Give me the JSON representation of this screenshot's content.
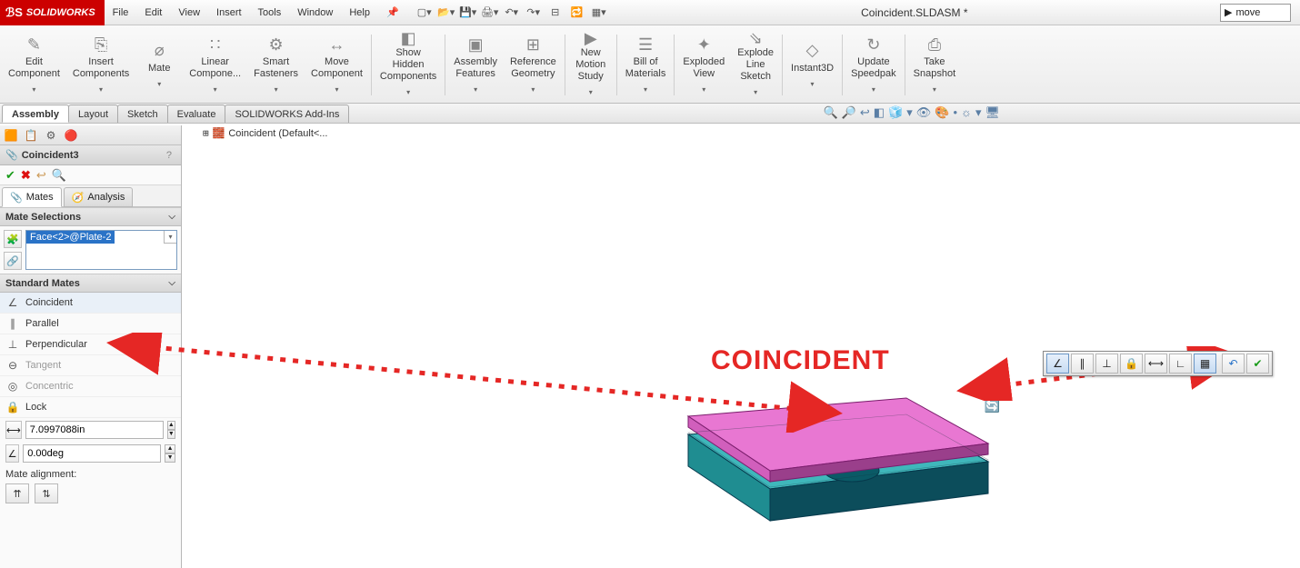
{
  "app": {
    "brand": "SOLIDWORKS",
    "title": "Coincident.SLDASM *",
    "search_value": "move"
  },
  "menu": {
    "items": [
      "File",
      "Edit",
      "View",
      "Insert",
      "Tools",
      "Window",
      "Help"
    ]
  },
  "ribbon": {
    "buttons": [
      {
        "label": "Edit\nComponent",
        "icon": "✎"
      },
      {
        "label": "Insert\nComponents",
        "icon": "⎘"
      },
      {
        "label": "Mate",
        "icon": "⌀"
      },
      {
        "label": "Linear\nCompone...",
        "icon": "∷"
      },
      {
        "label": "Smart\nFasteners",
        "icon": "⚙"
      },
      {
        "label": "Move\nComponent",
        "icon": "↔"
      },
      {
        "label": "|"
      },
      {
        "label": "Show\nHidden\nComponents",
        "icon": "◧"
      },
      {
        "label": "|"
      },
      {
        "label": "Assembly\nFeatures",
        "icon": "▣"
      },
      {
        "label": "Reference\nGeometry",
        "icon": "⊞"
      },
      {
        "label": "|"
      },
      {
        "label": "New\nMotion\nStudy",
        "icon": "▶"
      },
      {
        "label": "|"
      },
      {
        "label": "Bill of\nMaterials",
        "icon": "☰"
      },
      {
        "label": "|"
      },
      {
        "label": "Exploded\nView",
        "icon": "✦"
      },
      {
        "label": "Explode\nLine\nSketch",
        "icon": "⇘"
      },
      {
        "label": "|"
      },
      {
        "label": "Instant3D",
        "icon": "◇"
      },
      {
        "label": "|"
      },
      {
        "label": "Update\nSpeedpak",
        "icon": "↻"
      },
      {
        "label": "|"
      },
      {
        "label": "Take\nSnapshot",
        "icon": "⎙"
      }
    ]
  },
  "tabs": {
    "items": [
      "Assembly",
      "Layout",
      "Sketch",
      "Evaluate",
      "SOLIDWORKS Add-Ins"
    ],
    "active": 0
  },
  "tree": {
    "root": "Coincident  (Default<..."
  },
  "pm": {
    "title": "Coincident3",
    "subtabs": {
      "mates": "Mates",
      "analysis": "Analysis"
    },
    "selections_hdr": "Mate Selections",
    "selection_value": "Face<2>@Plate-2",
    "standard_hdr": "Standard Mates",
    "mates": [
      {
        "name": "Coincident",
        "glyph": "∠"
      },
      {
        "name": "Parallel",
        "glyph": "∥"
      },
      {
        "name": "Perpendicular",
        "glyph": "⊥"
      },
      {
        "name": "Tangent",
        "glyph": "⊖"
      },
      {
        "name": "Concentric",
        "glyph": "◎"
      },
      {
        "name": "Lock",
        "glyph": "🔒"
      }
    ],
    "distance_value": "7.0997088in",
    "angle_value": "0.00deg",
    "alignment_label": "Mate alignment:"
  },
  "annotation": {
    "label": "COINCIDENT"
  }
}
